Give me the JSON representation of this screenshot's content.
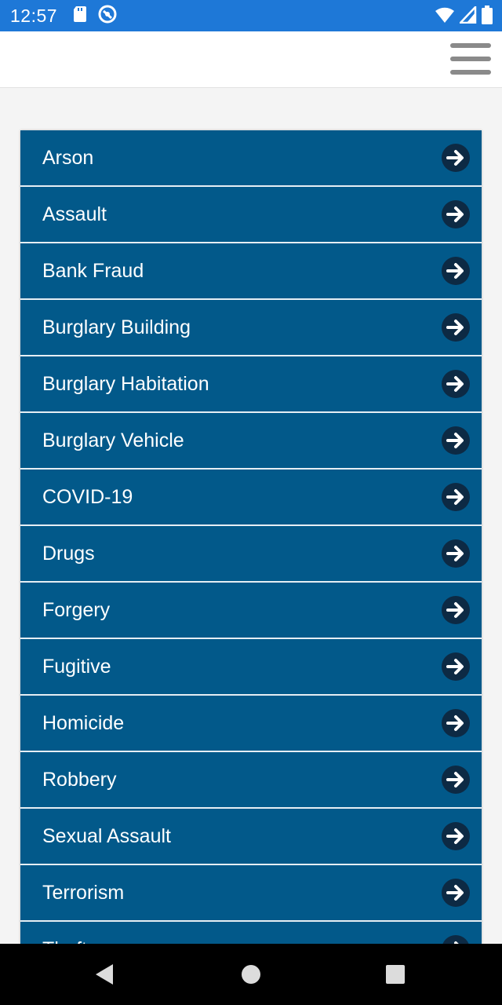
{
  "status_bar": {
    "time": "12:57",
    "left_icons": [
      "sd-card-icon",
      "vpn-icon"
    ],
    "right_icons": [
      "wifi-icon",
      "signal-icon",
      "battery-icon"
    ]
  },
  "header": {
    "menu_icon": "hamburger-menu-icon"
  },
  "colors": {
    "status_bar": "#1e78d7",
    "list_background": "#02598a",
    "arrow_circle": "#0d2a44"
  },
  "categories": [
    "Arson",
    "Assault",
    "Bank Fraud",
    "Burglary Building",
    "Burglary Habitation",
    "Burglary Vehicle",
    "COVID-19",
    "Drugs",
    "Forgery",
    "Fugitive",
    "Homicide",
    "Robbery",
    "Sexual Assault",
    "Terrorism",
    "Theft"
  ],
  "item_icon": "arrow-right-icon",
  "nav_bar": {
    "buttons": [
      "back-icon",
      "home-icon",
      "recents-icon"
    ]
  }
}
